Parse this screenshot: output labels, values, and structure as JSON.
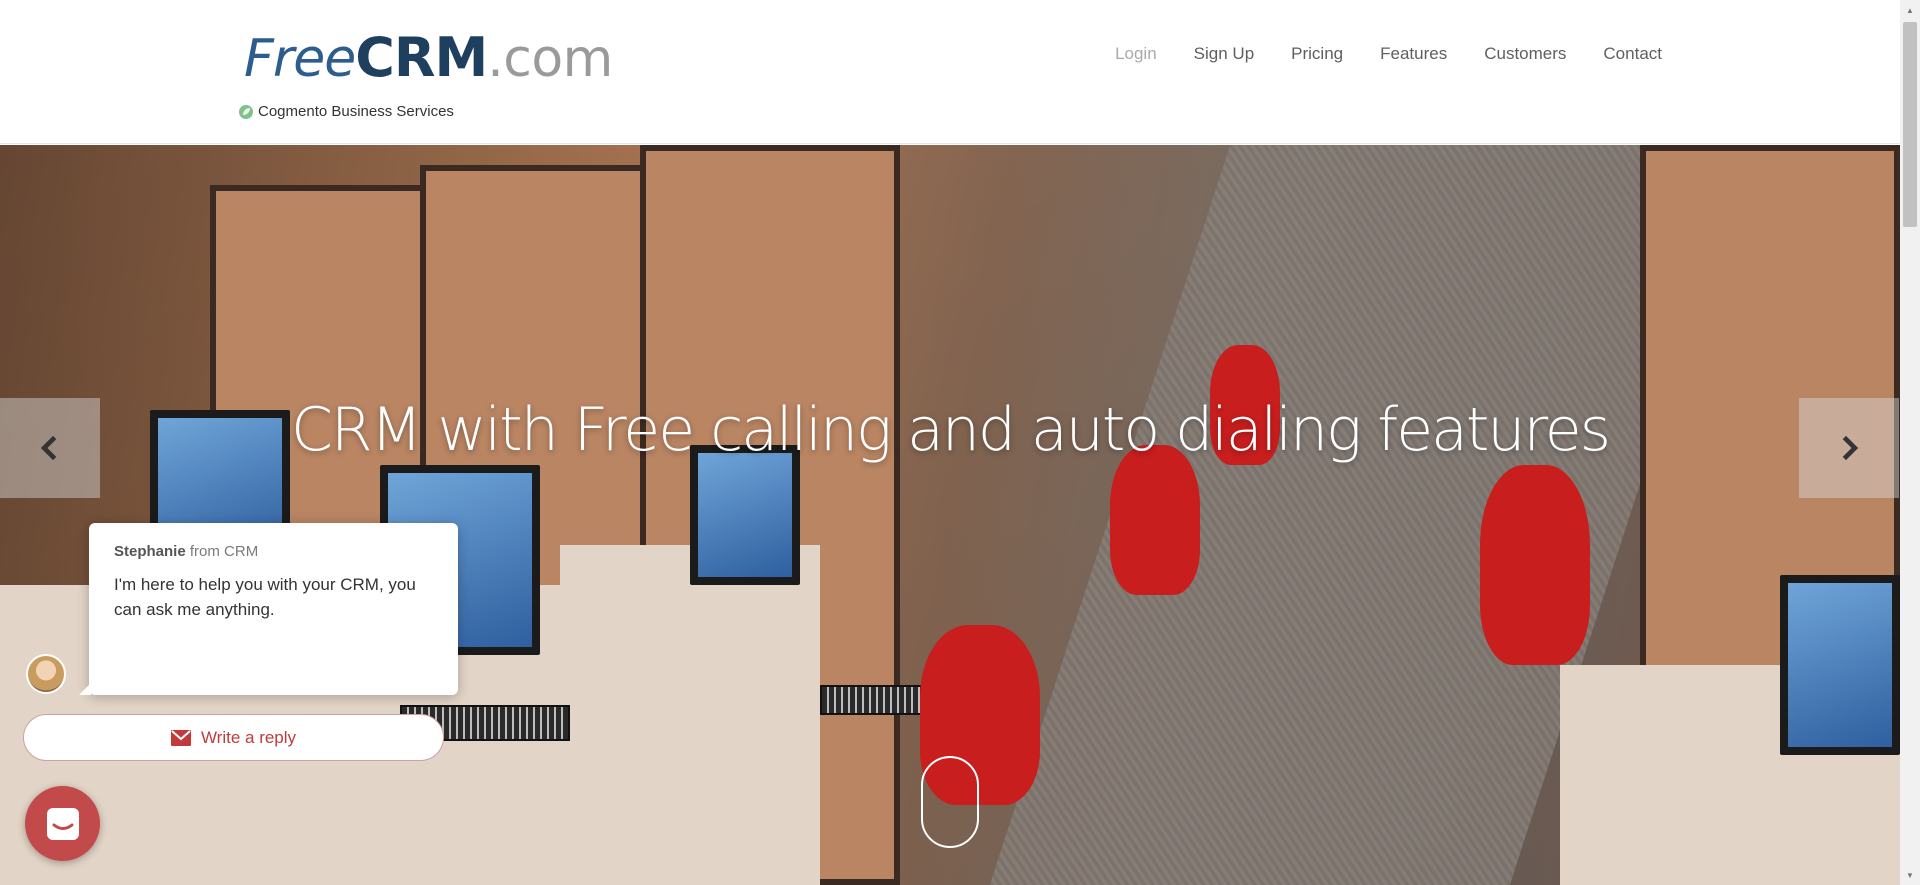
{
  "brand": {
    "logo_free": "Free",
    "logo_crm": "CRM",
    "logo_com": ".com",
    "tagline": "Cogmento Business Services",
    "colors": {
      "logo_blue": "#2c5d8e",
      "logo_dark": "#1f3f5f",
      "logo_gray": "#9a9a9a"
    }
  },
  "nav": {
    "items": [
      {
        "label": "Login",
        "icon": ""
      },
      {
        "label": "Sign Up"
      },
      {
        "label": "Pricing"
      },
      {
        "label": "Features"
      },
      {
        "label": "Customers"
      },
      {
        "label": "Contact"
      }
    ]
  },
  "hero": {
    "headline": "CRM with Free calling and auto dialing features",
    "prev_icon": "chevron-left-icon",
    "next_icon": "chevron-right-icon"
  },
  "chat": {
    "agent_name": "Stephanie",
    "agent_from": " from CRM",
    "message": "I'm here to help you with your CRM, you can ask me anything.",
    "reply_label": "Write a reply",
    "reply_icon": "envelope-icon",
    "launcher_icon": "chat-icon",
    "accent": "#c24a4a"
  }
}
